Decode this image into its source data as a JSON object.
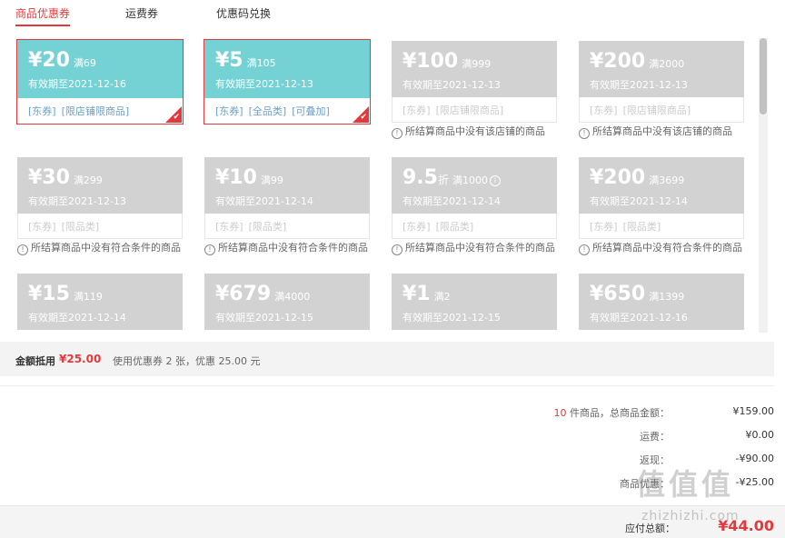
{
  "tabs": [
    {
      "label": "商品优惠券"
    },
    {
      "label": "运费券"
    },
    {
      "label": "优惠码兑换"
    }
  ],
  "coupons": [
    {
      "amount": "¥20",
      "cond": "满69",
      "validity": "有效期至2021-12-16",
      "tags": [
        "[东券]",
        "[限店铺限商品]"
      ],
      "note": ""
    },
    {
      "amount": "¥5",
      "cond": "满105",
      "validity": "有效期至2021-12-13",
      "tags": [
        "[东券]",
        "[全品类]",
        "[可叠加]"
      ],
      "note": ""
    },
    {
      "amount": "¥100",
      "cond": "满999",
      "validity": "有效期至2021-12-13",
      "tags": [
        "[东券]",
        "[限店铺限商品]"
      ],
      "note": "所结算商品中没有该店铺的商品"
    },
    {
      "amount": "¥200",
      "cond": "满2000",
      "validity": "有效期至2021-12-13",
      "tags": [
        "[东券]",
        "[限店铺限商品]"
      ],
      "note": "所结算商品中没有该店铺的商品"
    },
    {
      "amount": "¥30",
      "cond": "满299",
      "validity": "有效期至2021-12-13",
      "tags": [
        "[东券]",
        "[限品类]"
      ],
      "note": "所结算商品中没有符合条件的商品"
    },
    {
      "amount": "¥10",
      "cond": "满99",
      "validity": "有效期至2021-12-14",
      "tags": [
        "[东券]",
        "[限品类]"
      ],
      "note": "所结算商品中没有符合条件的商品"
    },
    {
      "amount": "9.5",
      "unit": "折",
      "cond": "满1000",
      "validity": "有效期至2021-12-14",
      "tags": [
        "[东券]",
        "[限品类]"
      ],
      "note": "所结算商品中没有符合条件的商品"
    },
    {
      "amount": "¥200",
      "cond": "满3699",
      "validity": "有效期至2021-12-14",
      "tags": [
        "[东券]",
        "[限品类]"
      ],
      "note": "所结算商品中没有符合条件的商品"
    },
    {
      "amount": "¥15",
      "cond": "满119",
      "validity": "有效期至2021-12-14"
    },
    {
      "amount": "¥679",
      "cond": "满4000",
      "validity": "有效期至2021-12-15"
    },
    {
      "amount": "¥1",
      "cond": "满2",
      "validity": "有效期至2021-12-15"
    },
    {
      "amount": "¥650",
      "cond": "满1399",
      "validity": "有效期至2021-12-16"
    }
  ],
  "summary": {
    "label": "金额抵用",
    "value": "¥25.00",
    "desc": "使用优惠券 2 张，优惠 25.00 元"
  },
  "totals": {
    "count": "10",
    "count_suffix": "件商品，总商品金额：",
    "goods_amount": "¥159.00",
    "freight_label": "运费：",
    "freight": "¥0.00",
    "cashback_label": "返现：",
    "cashback": "-¥90.00",
    "discount_label": "商品优惠：",
    "discount": "-¥25.00",
    "payable_label": "应付总额：",
    "payable": "¥44.00"
  },
  "watermark": {
    "text": "值值值",
    "sub": "zhizhizhi.com"
  },
  "colors": {
    "accent": "#e4393c",
    "active_coupon": "#75d2d4",
    "disabled_coupon": "#d2d2d2"
  }
}
